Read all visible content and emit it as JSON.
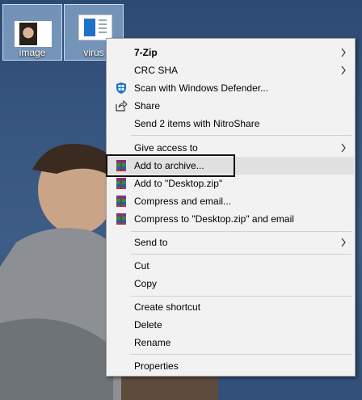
{
  "desktop": {
    "icons": [
      {
        "label": "image"
      },
      {
        "label": "virus"
      }
    ]
  },
  "context_menu": {
    "items": [
      {
        "label": "7-Zip",
        "submenu": true,
        "bold": true
      },
      {
        "label": "CRC SHA",
        "submenu": true
      },
      {
        "label": "Scan with Windows Defender...",
        "icon": "windows-defender-icon"
      },
      {
        "label": "Share",
        "icon": "share-icon"
      },
      {
        "label": "Send 2 items with NitroShare"
      },
      {
        "label": "Give access to",
        "submenu": true
      },
      {
        "label": "Add to archive...",
        "icon": "winrar-icon",
        "highlighted": true
      },
      {
        "label": "Add to \"Desktop.zip\"",
        "icon": "winrar-icon"
      },
      {
        "label": "Compress and email...",
        "icon": "winrar-icon"
      },
      {
        "label": "Compress to \"Desktop.zip\" and email",
        "icon": "winrar-icon"
      },
      {
        "label": "Send to",
        "submenu": true
      },
      {
        "label": "Cut"
      },
      {
        "label": "Copy"
      },
      {
        "label": "Create shortcut"
      },
      {
        "label": "Delete"
      },
      {
        "label": "Rename"
      },
      {
        "label": "Properties"
      }
    ]
  },
  "colors": {
    "menu_bg": "#f2f2f2",
    "hover_bg": "#e1e1e1",
    "desktop_bg": "#36557f"
  }
}
